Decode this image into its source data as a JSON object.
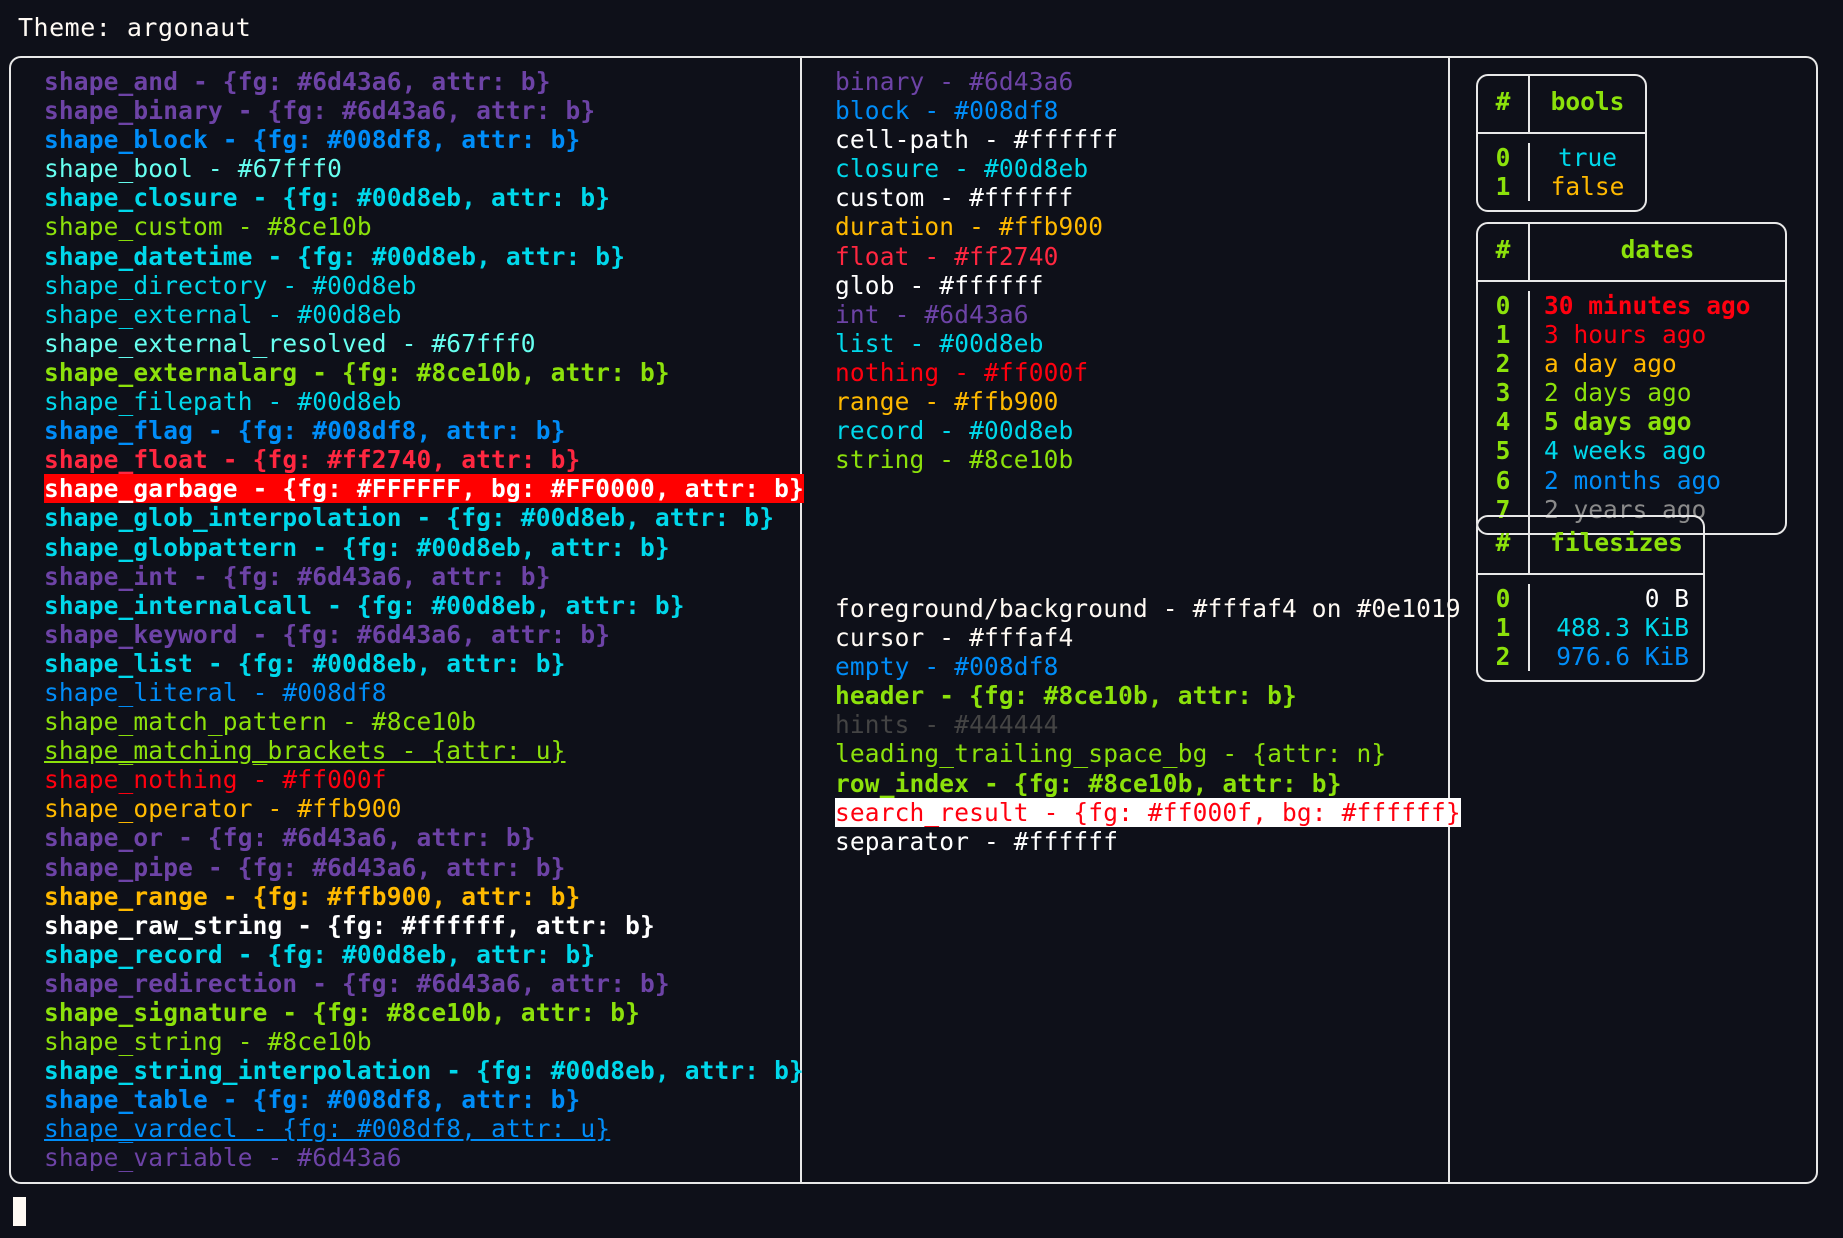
{
  "header": {
    "theme_label": "Theme: argonaut"
  },
  "palette": {
    "background": "#0e1019",
    "foreground": "#fffaf4",
    "purple": "#6d43a6",
    "blue": "#008df8",
    "cyan_bright": "#67fff0",
    "cyan": "#00d8eb",
    "green": "#8ce10b",
    "red": "#ff2740",
    "red_pure": "#ff000f",
    "orange": "#ffb900",
    "white": "#ffffff",
    "gray": "#444444",
    "gray_date": "#8a8a8a",
    "border": "#e8e8e8",
    "garbage_bg": "#FF0000",
    "search_bg": "#ffffff"
  },
  "left_column": {
    "lines": [
      {
        "text": "shape_and - {fg: #6d43a6, attr: b}",
        "color": "#6d43a6",
        "bold": true
      },
      {
        "text": "shape_binary - {fg: #6d43a6, attr: b}",
        "color": "#6d43a6",
        "bold": true
      },
      {
        "text": "shape_block - {fg: #008df8, attr: b}",
        "color": "#008df8",
        "bold": true
      },
      {
        "text": "shape_bool - #67fff0",
        "color": "#67fff0",
        "bold": false
      },
      {
        "text": "shape_closure - {fg: #00d8eb, attr: b}",
        "color": "#00d8eb",
        "bold": true
      },
      {
        "text": "shape_custom - #8ce10b",
        "color": "#8ce10b",
        "bold": false
      },
      {
        "text": "shape_datetime - {fg: #00d8eb, attr: b}",
        "color": "#00d8eb",
        "bold": true
      },
      {
        "text": "shape_directory - #00d8eb",
        "color": "#00d8eb",
        "bold": false
      },
      {
        "text": "shape_external - #00d8eb",
        "color": "#00d8eb",
        "bold": false
      },
      {
        "text": "shape_external_resolved - #67fff0",
        "color": "#67fff0",
        "bold": false
      },
      {
        "text": "shape_externalarg - {fg: #8ce10b, attr: b}",
        "color": "#8ce10b",
        "bold": true
      },
      {
        "text": "shape_filepath - #00d8eb",
        "color": "#00d8eb",
        "bold": false
      },
      {
        "text": "shape_flag - {fg: #008df8, attr: b}",
        "color": "#008df8",
        "bold": true
      },
      {
        "text": "shape_float - {fg: #ff2740, attr: b}",
        "color": "#ff2740",
        "bold": true
      },
      {
        "text": "shape_garbage - {fg: #FFFFFF, bg: #FF0000, attr: b}",
        "color": "#FFFFFF",
        "bg": "#FF0000",
        "bold": true
      },
      {
        "text": "shape_glob_interpolation - {fg: #00d8eb, attr: b}",
        "color": "#00d8eb",
        "bold": true
      },
      {
        "text": "shape_globpattern - {fg: #00d8eb, attr: b}",
        "color": "#00d8eb",
        "bold": true
      },
      {
        "text": "shape_int - {fg: #6d43a6, attr: b}",
        "color": "#6d43a6",
        "bold": true
      },
      {
        "text": "shape_internalcall - {fg: #00d8eb, attr: b}",
        "color": "#00d8eb",
        "bold": true
      },
      {
        "text": "shape_keyword - {fg: #6d43a6, attr: b}",
        "color": "#6d43a6",
        "bold": true
      },
      {
        "text": "shape_list - {fg: #00d8eb, attr: b}",
        "color": "#00d8eb",
        "bold": true
      },
      {
        "text": "shape_literal - #008df8",
        "color": "#008df8",
        "bold": false
      },
      {
        "text": "shape_match_pattern - #8ce10b",
        "color": "#8ce10b",
        "bold": false
      },
      {
        "text": "shape_matching_brackets - {attr: u}",
        "color": "#8ce10b",
        "bold": false,
        "underline": true
      },
      {
        "text": "shape_nothing - #ff000f",
        "color": "#ff000f",
        "bold": false
      },
      {
        "text": "shape_operator - #ffb900",
        "color": "#ffb900",
        "bold": false
      },
      {
        "text": "shape_or - {fg: #6d43a6, attr: b}",
        "color": "#6d43a6",
        "bold": true
      },
      {
        "text": "shape_pipe - {fg: #6d43a6, attr: b}",
        "color": "#6d43a6",
        "bold": true
      },
      {
        "text": "shape_range - {fg: #ffb900, attr: b}",
        "color": "#ffb900",
        "bold": true
      },
      {
        "text": "shape_raw_string - {fg: #ffffff, attr: b}",
        "color": "#ffffff",
        "bold": true
      },
      {
        "text": "shape_record - {fg: #00d8eb, attr: b}",
        "color": "#00d8eb",
        "bold": true
      },
      {
        "text": "shape_redirection - {fg: #6d43a6, attr: b}",
        "color": "#6d43a6",
        "bold": true
      },
      {
        "text": "shape_signature - {fg: #8ce10b, attr: b}",
        "color": "#8ce10b",
        "bold": true
      },
      {
        "text": "shape_string - #8ce10b",
        "color": "#8ce10b",
        "bold": false
      },
      {
        "text": "shape_string_interpolation - {fg: #00d8eb, attr: b}",
        "color": "#00d8eb",
        "bold": true
      },
      {
        "text": "shape_table - {fg: #008df8, attr: b}",
        "color": "#008df8",
        "bold": true
      },
      {
        "text": "shape_vardecl - {fg: #008df8, attr: u}",
        "color": "#008df8",
        "bold": false,
        "underline": true
      },
      {
        "text": "shape_variable - #6d43a6",
        "color": "#6d43a6",
        "bold": false
      }
    ]
  },
  "middle_column": {
    "block_types": [
      {
        "text": "binary - #6d43a6",
        "color": "#6d43a6",
        "bold": false
      },
      {
        "text": "block - #008df8",
        "color": "#008df8",
        "bold": false
      },
      {
        "text": "cell-path - #ffffff",
        "color": "#ffffff",
        "bold": false
      },
      {
        "text": "closure - #00d8eb",
        "color": "#00d8eb",
        "bold": false
      },
      {
        "text": "custom - #ffffff",
        "color": "#ffffff",
        "bold": false
      },
      {
        "text": "duration - #ffb900",
        "color": "#ffb900",
        "bold": false
      },
      {
        "text": "float - #ff2740",
        "color": "#ff2740",
        "bold": false
      },
      {
        "text": "glob - #ffffff",
        "color": "#ffffff",
        "bold": false
      },
      {
        "text": "int - #6d43a6",
        "color": "#6d43a6",
        "bold": false
      },
      {
        "text": "list - #00d8eb",
        "color": "#00d8eb",
        "bold": false
      },
      {
        "text": "nothing - #ff000f",
        "color": "#ff000f",
        "bold": false
      },
      {
        "text": "range - #ffb900",
        "color": "#ffb900",
        "bold": false
      },
      {
        "text": "record - #00d8eb",
        "color": "#00d8eb",
        "bold": false
      },
      {
        "text": "string - #8ce10b",
        "color": "#8ce10b",
        "bold": false
      }
    ],
    "block_ui": [
      {
        "text": "foreground/background - #fffaf4 on #0e1019",
        "color": "#fffaf4",
        "bold": false
      },
      {
        "text": "cursor - #fffaf4",
        "color": "#fffaf4",
        "bold": false
      },
      {
        "text": "empty - #008df8",
        "color": "#008df8",
        "bold": false
      },
      {
        "text": "header - {fg: #8ce10b, attr: b}",
        "color": "#8ce10b",
        "bold": true
      },
      {
        "text": "hints - #444444",
        "color": "#444444",
        "bold": false
      },
      {
        "text": "leading_trailing_space_bg - {attr: n}",
        "color": "#8ce10b",
        "bold": false
      },
      {
        "text": "row_index - {fg: #8ce10b, attr: b}",
        "color": "#8ce10b",
        "bold": true
      },
      {
        "text": "search_result - {fg: #ff000f, bg: #ffffff}",
        "color": "#ff000f",
        "bg": "#ffffff",
        "bold": false
      },
      {
        "text": "separator - #ffffff",
        "color": "#ffffff",
        "bold": false
      }
    ]
  },
  "right_column": {
    "tables": [
      {
        "name": "bools",
        "headers": [
          "#",
          "bools"
        ],
        "align": "center",
        "rows": [
          {
            "index": "0",
            "value": "true",
            "color": "#00d8eb",
            "bold": false
          },
          {
            "index": "1",
            "value": "false",
            "color": "#ffb900",
            "bold": false
          }
        ]
      },
      {
        "name": "dates",
        "headers": [
          "#",
          "dates"
        ],
        "align": "left",
        "rows": [
          {
            "index": "0",
            "value": "30 minutes ago",
            "color": "#ff000f",
            "bold": true
          },
          {
            "index": "1",
            "value": "3 hours ago",
            "color": "#ff000f",
            "bold": false
          },
          {
            "index": "2",
            "value": "a day ago",
            "color": "#ffb900",
            "bold": false
          },
          {
            "index": "3",
            "value": "2 days ago",
            "color": "#8ce10b",
            "bold": false
          },
          {
            "index": "4",
            "value": "5 days ago",
            "color": "#8ce10b",
            "bold": true
          },
          {
            "index": "5",
            "value": "4 weeks ago",
            "color": "#00d8eb",
            "bold": false
          },
          {
            "index": "6",
            "value": "2 months ago",
            "color": "#008df8",
            "bold": false
          },
          {
            "index": "7",
            "value": "2 years ago",
            "color": "#8a8a8a",
            "bold": false
          }
        ]
      },
      {
        "name": "filesizes",
        "headers": [
          "#",
          "filesizes"
        ],
        "align": "right",
        "rows": [
          {
            "index": "0",
            "value": "0 B",
            "color": "#ffffff",
            "bold": false
          },
          {
            "index": "1",
            "value": "488.3 KiB",
            "color": "#00d8eb",
            "bold": false
          },
          {
            "index": "2",
            "value": "976.6 KiB",
            "color": "#008df8",
            "bold": false
          }
        ]
      }
    ]
  }
}
